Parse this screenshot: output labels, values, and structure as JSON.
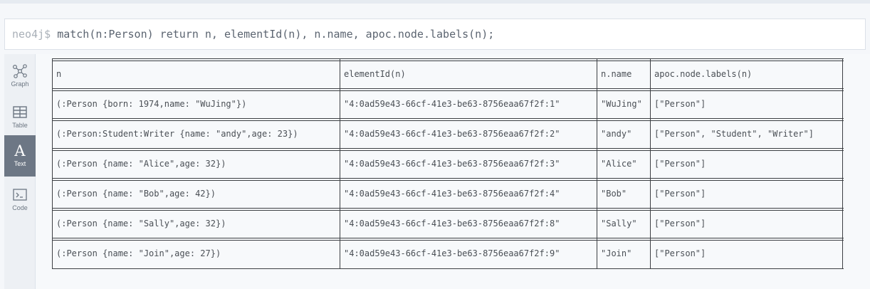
{
  "command": {
    "prompt": "neo4j$",
    "query": "match(n:Person) return n, elementId(n), n.name, apoc.node.labels(n);"
  },
  "sidebar": {
    "items": [
      {
        "label": "Graph",
        "icon": "graph-icon",
        "active": false
      },
      {
        "label": "Table",
        "icon": "table-icon",
        "active": false
      },
      {
        "label": "Text",
        "icon": "text-icon",
        "active": true
      },
      {
        "label": "Code",
        "icon": "code-icon",
        "active": false
      }
    ]
  },
  "table": {
    "columns": [
      "n",
      "elementId(n)",
      "n.name",
      "apoc.node.labels(n)"
    ],
    "rows": [
      [
        "(:Person {born: 1974,name: \"WuJing\"})",
        "\"4:0ad59e43-66cf-41e3-be63-8756eaa67f2f:1\"",
        "\"WuJing\"",
        "[\"Person\"]"
      ],
      [
        "(:Person:Student:Writer {name: \"andy\",age: 23})",
        "\"4:0ad59e43-66cf-41e3-be63-8756eaa67f2f:2\"",
        "\"andy\"",
        "[\"Person\", \"Student\", \"Writer\"]"
      ],
      [
        "(:Person {name: \"Alice\",age: 32})",
        "\"4:0ad59e43-66cf-41e3-be63-8756eaa67f2f:3\"",
        "\"Alice\"",
        "[\"Person\"]"
      ],
      [
        "(:Person {name: \"Bob\",age: 42})",
        "\"4:0ad59e43-66cf-41e3-be63-8756eaa67f2f:4\"",
        "\"Bob\"",
        "[\"Person\"]"
      ],
      [
        "(:Person {name: \"Sally\",age: 32})",
        "\"4:0ad59e43-66cf-41e3-be63-8756eaa67f2f:8\"",
        "\"Sally\"",
        "[\"Person\"]"
      ],
      [
        "(:Person {name: \"Join\",age: 27})",
        "\"4:0ad59e43-66cf-41e3-be63-8756eaa67f2f:9\"",
        "\"Join\"",
        "[\"Person\"]"
      ]
    ]
  }
}
